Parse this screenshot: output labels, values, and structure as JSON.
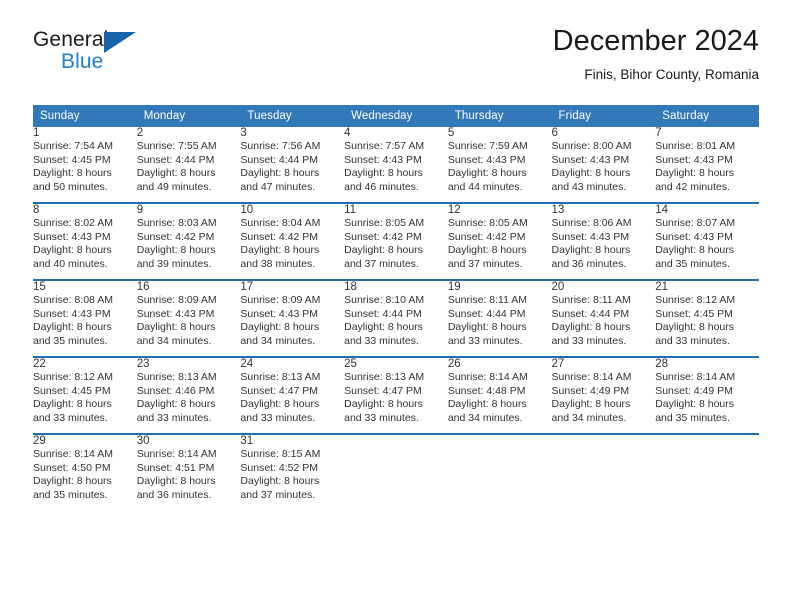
{
  "brand": {
    "line1": "General",
    "line2": "Blue",
    "accent_color": "#1f7fd1",
    "triangle_color": "#1565a8"
  },
  "header": {
    "title": "December 2024",
    "location": "Finis, Bihor County, Romania"
  },
  "theme": {
    "header_bg": "#3378b8",
    "week_separator": "#1f6fb5",
    "daynum_bg": "#f0f0f0",
    "text": "#333333"
  },
  "weekdays": [
    "Sunday",
    "Monday",
    "Tuesday",
    "Wednesday",
    "Thursday",
    "Friday",
    "Saturday"
  ],
  "weeks": [
    [
      {
        "day": "1",
        "sunrise": "Sunrise: 7:54 AM",
        "sunset": "Sunset: 4:45 PM",
        "daylight1": "Daylight: 8 hours",
        "daylight2": "and 50 minutes."
      },
      {
        "day": "2",
        "sunrise": "Sunrise: 7:55 AM",
        "sunset": "Sunset: 4:44 PM",
        "daylight1": "Daylight: 8 hours",
        "daylight2": "and 49 minutes."
      },
      {
        "day": "3",
        "sunrise": "Sunrise: 7:56 AM",
        "sunset": "Sunset: 4:44 PM",
        "daylight1": "Daylight: 8 hours",
        "daylight2": "and 47 minutes."
      },
      {
        "day": "4",
        "sunrise": "Sunrise: 7:57 AM",
        "sunset": "Sunset: 4:43 PM",
        "daylight1": "Daylight: 8 hours",
        "daylight2": "and 46 minutes."
      },
      {
        "day": "5",
        "sunrise": "Sunrise: 7:59 AM",
        "sunset": "Sunset: 4:43 PM",
        "daylight1": "Daylight: 8 hours",
        "daylight2": "and 44 minutes."
      },
      {
        "day": "6",
        "sunrise": "Sunrise: 8:00 AM",
        "sunset": "Sunset: 4:43 PM",
        "daylight1": "Daylight: 8 hours",
        "daylight2": "and 43 minutes."
      },
      {
        "day": "7",
        "sunrise": "Sunrise: 8:01 AM",
        "sunset": "Sunset: 4:43 PM",
        "daylight1": "Daylight: 8 hours",
        "daylight2": "and 42 minutes."
      }
    ],
    [
      {
        "day": "8",
        "sunrise": "Sunrise: 8:02 AM",
        "sunset": "Sunset: 4:43 PM",
        "daylight1": "Daylight: 8 hours",
        "daylight2": "and 40 minutes."
      },
      {
        "day": "9",
        "sunrise": "Sunrise: 8:03 AM",
        "sunset": "Sunset: 4:42 PM",
        "daylight1": "Daylight: 8 hours",
        "daylight2": "and 39 minutes."
      },
      {
        "day": "10",
        "sunrise": "Sunrise: 8:04 AM",
        "sunset": "Sunset: 4:42 PM",
        "daylight1": "Daylight: 8 hours",
        "daylight2": "and 38 minutes."
      },
      {
        "day": "11",
        "sunrise": "Sunrise: 8:05 AM",
        "sunset": "Sunset: 4:42 PM",
        "daylight1": "Daylight: 8 hours",
        "daylight2": "and 37 minutes."
      },
      {
        "day": "12",
        "sunrise": "Sunrise: 8:05 AM",
        "sunset": "Sunset: 4:42 PM",
        "daylight1": "Daylight: 8 hours",
        "daylight2": "and 37 minutes."
      },
      {
        "day": "13",
        "sunrise": "Sunrise: 8:06 AM",
        "sunset": "Sunset: 4:43 PM",
        "daylight1": "Daylight: 8 hours",
        "daylight2": "and 36 minutes."
      },
      {
        "day": "14",
        "sunrise": "Sunrise: 8:07 AM",
        "sunset": "Sunset: 4:43 PM",
        "daylight1": "Daylight: 8 hours",
        "daylight2": "and 35 minutes."
      }
    ],
    [
      {
        "day": "15",
        "sunrise": "Sunrise: 8:08 AM",
        "sunset": "Sunset: 4:43 PM",
        "daylight1": "Daylight: 8 hours",
        "daylight2": "and 35 minutes."
      },
      {
        "day": "16",
        "sunrise": "Sunrise: 8:09 AM",
        "sunset": "Sunset: 4:43 PM",
        "daylight1": "Daylight: 8 hours",
        "daylight2": "and 34 minutes."
      },
      {
        "day": "17",
        "sunrise": "Sunrise: 8:09 AM",
        "sunset": "Sunset: 4:43 PM",
        "daylight1": "Daylight: 8 hours",
        "daylight2": "and 34 minutes."
      },
      {
        "day": "18",
        "sunrise": "Sunrise: 8:10 AM",
        "sunset": "Sunset: 4:44 PM",
        "daylight1": "Daylight: 8 hours",
        "daylight2": "and 33 minutes."
      },
      {
        "day": "19",
        "sunrise": "Sunrise: 8:11 AM",
        "sunset": "Sunset: 4:44 PM",
        "daylight1": "Daylight: 8 hours",
        "daylight2": "and 33 minutes."
      },
      {
        "day": "20",
        "sunrise": "Sunrise: 8:11 AM",
        "sunset": "Sunset: 4:44 PM",
        "daylight1": "Daylight: 8 hours",
        "daylight2": "and 33 minutes."
      },
      {
        "day": "21",
        "sunrise": "Sunrise: 8:12 AM",
        "sunset": "Sunset: 4:45 PM",
        "daylight1": "Daylight: 8 hours",
        "daylight2": "and 33 minutes."
      }
    ],
    [
      {
        "day": "22",
        "sunrise": "Sunrise: 8:12 AM",
        "sunset": "Sunset: 4:45 PM",
        "daylight1": "Daylight: 8 hours",
        "daylight2": "and 33 minutes."
      },
      {
        "day": "23",
        "sunrise": "Sunrise: 8:13 AM",
        "sunset": "Sunset: 4:46 PM",
        "daylight1": "Daylight: 8 hours",
        "daylight2": "and 33 minutes."
      },
      {
        "day": "24",
        "sunrise": "Sunrise: 8:13 AM",
        "sunset": "Sunset: 4:47 PM",
        "daylight1": "Daylight: 8 hours",
        "daylight2": "and 33 minutes."
      },
      {
        "day": "25",
        "sunrise": "Sunrise: 8:13 AM",
        "sunset": "Sunset: 4:47 PM",
        "daylight1": "Daylight: 8 hours",
        "daylight2": "and 33 minutes."
      },
      {
        "day": "26",
        "sunrise": "Sunrise: 8:14 AM",
        "sunset": "Sunset: 4:48 PM",
        "daylight1": "Daylight: 8 hours",
        "daylight2": "and 34 minutes."
      },
      {
        "day": "27",
        "sunrise": "Sunrise: 8:14 AM",
        "sunset": "Sunset: 4:49 PM",
        "daylight1": "Daylight: 8 hours",
        "daylight2": "and 34 minutes."
      },
      {
        "day": "28",
        "sunrise": "Sunrise: 8:14 AM",
        "sunset": "Sunset: 4:49 PM",
        "daylight1": "Daylight: 8 hours",
        "daylight2": "and 35 minutes."
      }
    ],
    [
      {
        "day": "29",
        "sunrise": "Sunrise: 8:14 AM",
        "sunset": "Sunset: 4:50 PM",
        "daylight1": "Daylight: 8 hours",
        "daylight2": "and 35 minutes."
      },
      {
        "day": "30",
        "sunrise": "Sunrise: 8:14 AM",
        "sunset": "Sunset: 4:51 PM",
        "daylight1": "Daylight: 8 hours",
        "daylight2": "and 36 minutes."
      },
      {
        "day": "31",
        "sunrise": "Sunrise: 8:15 AM",
        "sunset": "Sunset: 4:52 PM",
        "daylight1": "Daylight: 8 hours",
        "daylight2": "and 37 minutes."
      },
      {
        "day": "",
        "sunrise": "",
        "sunset": "",
        "daylight1": "",
        "daylight2": ""
      },
      {
        "day": "",
        "sunrise": "",
        "sunset": "",
        "daylight1": "",
        "daylight2": ""
      },
      {
        "day": "",
        "sunrise": "",
        "sunset": "",
        "daylight1": "",
        "daylight2": ""
      },
      {
        "day": "",
        "sunrise": "",
        "sunset": "",
        "daylight1": "",
        "daylight2": ""
      }
    ]
  ]
}
